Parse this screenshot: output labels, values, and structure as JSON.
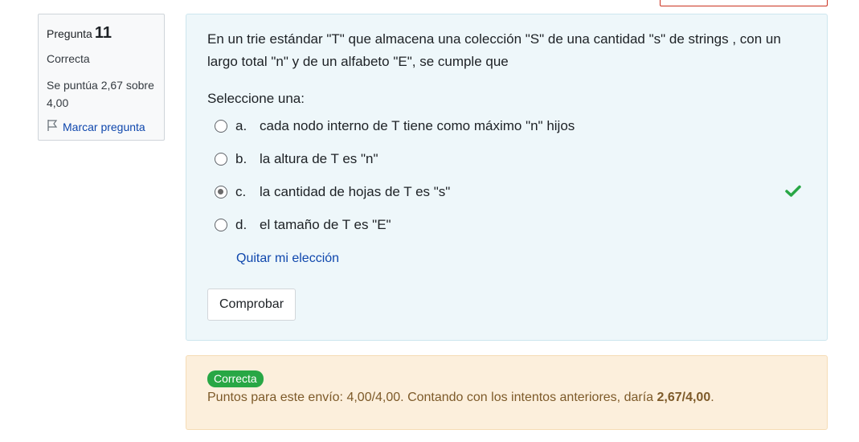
{
  "info": {
    "question_word": "Pregunta",
    "question_number": "11",
    "state": "Correcta",
    "grade_text": "Se puntúa 2,67 sobre 4,00",
    "flag_label": "Marcar pregunta"
  },
  "question": {
    "text": "En un trie estándar \"T\" que almacena una colección \"S\" de una cantidad \"s\" de strings , con un largo total \"n\" y de un alfabeto \"E\", se cumple que",
    "prompt": "Seleccione una:",
    "answers": [
      {
        "letter": "a.",
        "text": "cada nodo interno de T tiene como máximo \"n\" hijos",
        "checked": false
      },
      {
        "letter": "b.",
        "text": "la altura de T es \"n\"",
        "checked": false
      },
      {
        "letter": "c.",
        "text": "la cantidad de hojas de T es \"s\"",
        "checked": true
      },
      {
        "letter": "d.",
        "text": "el tamaño de T es \"E\"",
        "checked": false
      }
    ],
    "clear_label": "Quitar mi elección",
    "check_button": "Comprobar"
  },
  "feedback": {
    "badge": "Correcta",
    "points_prefix": "Puntos para este envío: 4,00/4,00. Contando con los intentos anteriores, daría ",
    "points_bold": "2,67/4,00",
    "points_suffix": "."
  },
  "colors": {
    "correct_green": "#28a745",
    "link_blue": "#0f47ad",
    "formulation_bg": "#eef7fa",
    "feedback_bg": "#fcefdc"
  },
  "icons": {
    "flag": "flag-icon",
    "correct": "check-icon"
  }
}
